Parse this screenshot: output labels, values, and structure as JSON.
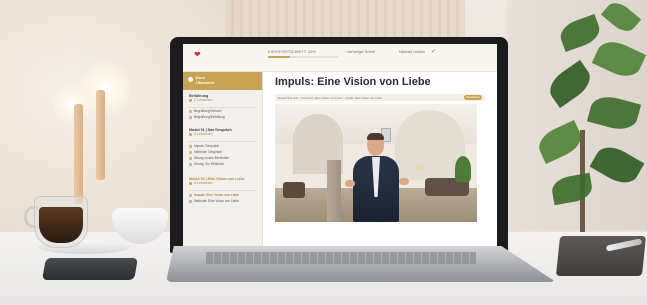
{
  "app": {
    "progress_label": "KURSFORTSCHRITT: 32%",
    "progress_fraction": 0.32,
    "prev_label": "Vorheriger Schritt",
    "next_label": "Nächste Lektion",
    "logo_icon": "heart-logo-icon",
    "accent_color": "#c9a253"
  },
  "sidebar": {
    "header": "Kurs\nÜbersicht",
    "modules": [
      {
        "title": "Einführung",
        "subtitle": "2 Lektionen",
        "lessons": [
          "Begrüßung/Vorwort",
          "Begrüßung/Einleitung"
        ]
      },
      {
        "title": "Modul 01 | Das Gespräch",
        "subtitle": "4 Lektionen",
        "lessons": [
          "Impuls: Gespräch",
          "Methode: Gespräch",
          "Übung zu den Bereichen",
          "Übung: Zur Reflexion"
        ]
      },
      {
        "title": "Modul 02 | Eine Vision von Liebe",
        "subtitle": "4 Lektionen",
        "lessons": [
          "Impuls: Eine Vision von Liebe",
          "Methode: Eine Vision von Liebe"
        ]
      }
    ]
  },
  "main": {
    "title": "Impuls: Eine Vision von Liebe",
    "breadcrumb": "Modul Übersicht > Modul 02 | Eine Vision von Liebe > Impuls: Eine Vision von Liebe",
    "breadcrumb_pill": "Abschließen",
    "video_alt": "Sprecher in einem Gewölberaum"
  }
}
